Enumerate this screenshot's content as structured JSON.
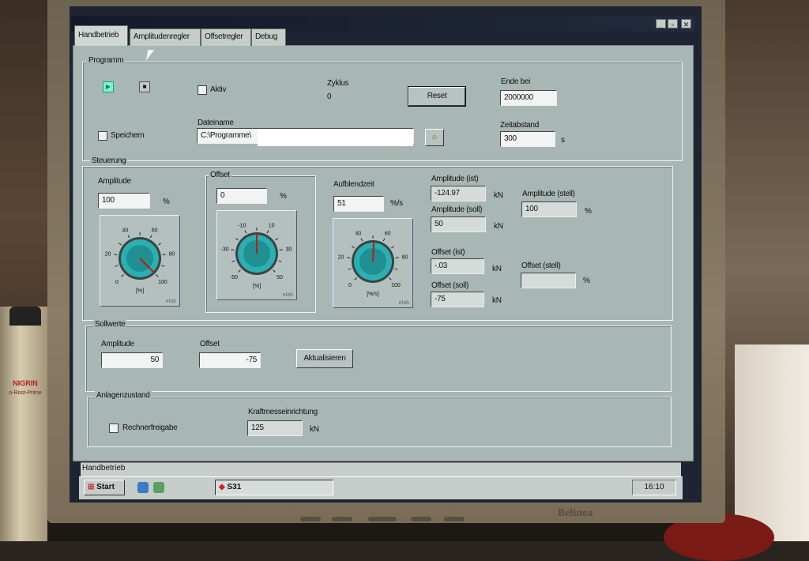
{
  "tabs": [
    "Handbetrieb",
    "Amplitudenregler",
    "Offsetregler",
    "Debug"
  ],
  "programm": {
    "title": "Programm",
    "aktiv_label": "Aktiv",
    "zyklus_label": "Zyklus",
    "zyklus_value": "0",
    "reset_label": "Reset",
    "ende_label": "Ende bei",
    "ende_value": "2000000",
    "speichern_label": "Speichern",
    "dateiname_label": "Dateiname",
    "dateiname_value": "C:\\Programme\\",
    "zeitabstand_label": "Zeitabstand",
    "zeitabstand_value": "300",
    "zeitabstand_unit": "s"
  },
  "steuerung": {
    "title": "Steuerung",
    "amplitude_label": "Amplitude",
    "amplitude_value": "100",
    "amplitude_unit": "%",
    "offset_label": "Offset",
    "offset_value": "0",
    "offset_unit": "%",
    "aufblend_label": "Aufblendzeit",
    "aufblend_value": "51",
    "aufblend_unit": "%/s",
    "amp_ist_label": "Amplitude (ist)",
    "amp_ist_value": "-124.97",
    "amp_soll_label": "Amplitude (soll)",
    "amp_soll_value": "50",
    "off_ist_label": "Offset (ist)",
    "off_ist_value": "-.03",
    "off_soll_label": "Offset (soll)",
    "off_soll_value": "-75",
    "amp_stell_label": "Amplitude (stell)",
    "amp_stell_value": "100",
    "off_stell_label": "Offset (stell)",
    "off_stell_value": "",
    "kn": "kN",
    "pct": "%",
    "knob_amplitude": {
      "value": 100,
      "min": 0,
      "max": 100,
      "ticks": [
        "0",
        "20",
        "40",
        "60",
        "80",
        "100"
      ],
      "unit": "[%]"
    },
    "knob_offset": {
      "value": 0,
      "min": -50,
      "max": 50,
      "ticks": [
        "-50",
        "-30",
        "-10",
        "10",
        "30",
        "50"
      ],
      "unit": "[%]"
    },
    "knob_aufblend": {
      "value": 51,
      "min": 0,
      "max": 100,
      "ticks": [
        "0",
        "20",
        "40",
        "60",
        "80",
        "100"
      ],
      "unit": "[%/s]"
    },
    "elab": "elab"
  },
  "sollwerte": {
    "title": "Sollwerte",
    "amplitude_label": "Amplitude",
    "amplitude_value": "50",
    "offset_label": "Offset",
    "offset_value": "-75",
    "aktualisieren_label": "Aktualisieren"
  },
  "anlagenzustand": {
    "title": "Anlagenzustand",
    "rechner_label": "Rechnerfreigabe",
    "kraft_label": "Kraftmesseinrichtung",
    "kraft_value": "125",
    "kraft_unit": "kN"
  },
  "statusbar": {
    "left": "Handbetrieb"
  },
  "taskbar": {
    "start": "Start",
    "task": "S31",
    "clock": "16:10"
  },
  "monitor": {
    "brand": "Belinea"
  },
  "can": {
    "brand": "NIGRIN",
    "product": "o-Rost-Prime"
  },
  "colors": {
    "knob_teal": "#2ab0b0",
    "knob_needle": "#c01818",
    "panel": "#a8b6b4"
  }
}
